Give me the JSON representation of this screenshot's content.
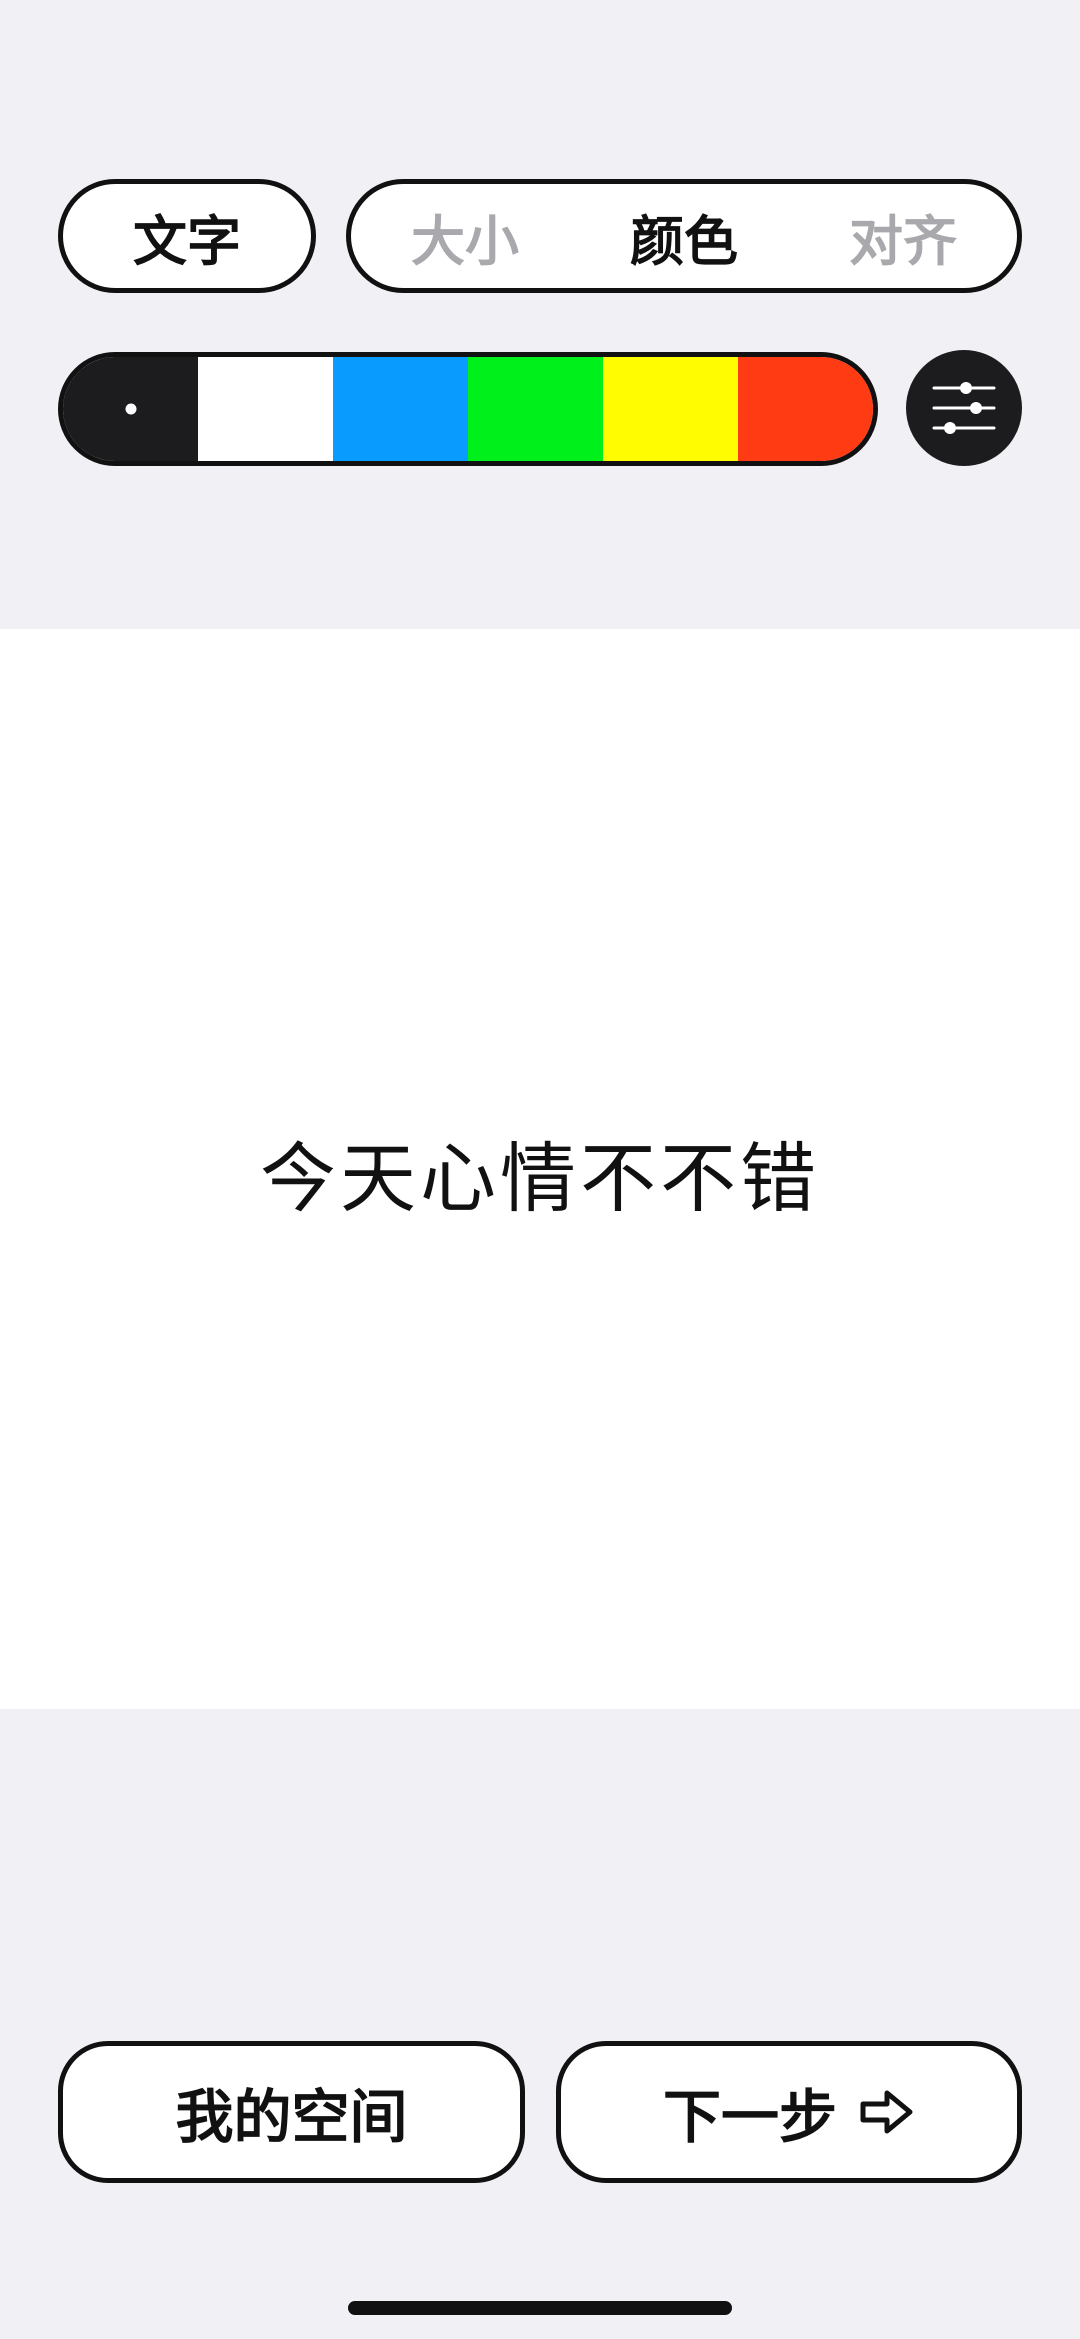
{
  "toolbar": {
    "text_button_label": "文字",
    "modes": [
      {
        "label": "大小",
        "state": "inactive"
      },
      {
        "label": "颜色",
        "state": "active"
      },
      {
        "label": "对齐",
        "state": "inactive"
      }
    ]
  },
  "palette": {
    "selected_index": 0,
    "colors": [
      "#1c1c1e",
      "#ffffff",
      "#0a9bff",
      "#00f01c",
      "#fffb00",
      "#ff3b13"
    ]
  },
  "settings_icon": "sliders-icon",
  "canvas": {
    "text": "今天心情不不错",
    "background": "#ffffff"
  },
  "bottom": {
    "my_space_label": "我的空间",
    "next_label": "下一步",
    "next_icon": "arrow-right-outline-icon"
  }
}
